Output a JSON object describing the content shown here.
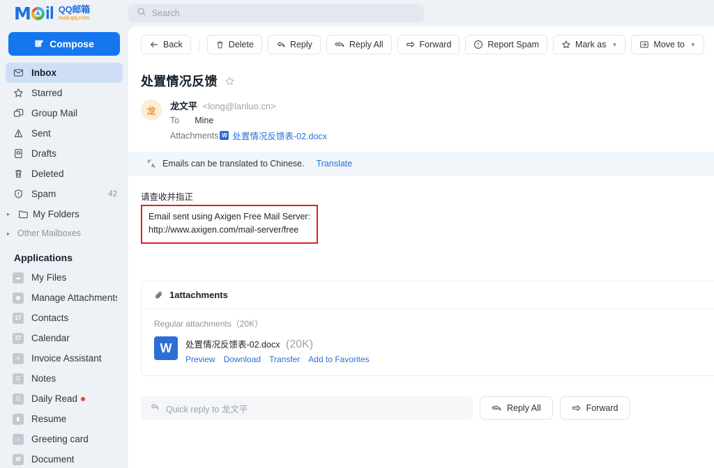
{
  "brand": {
    "word_m": "M",
    "word_il": "il",
    "cn_name": "QQ邮箱",
    "domain": "mail.qq.com"
  },
  "compose": {
    "label": "Compose",
    "icon": "compose-icon"
  },
  "search": {
    "placeholder": "Search",
    "icon": "search-icon"
  },
  "sidebar": {
    "items": [
      {
        "label": "Inbox",
        "icon": "inbox-icon",
        "count": "",
        "active": true
      },
      {
        "label": "Starred",
        "icon": "star-icon",
        "count": "",
        "active": false
      },
      {
        "label": "Group Mail",
        "icon": "group-mail-icon",
        "count": "",
        "active": false
      },
      {
        "label": "Sent",
        "icon": "sent-icon",
        "count": "",
        "active": false
      },
      {
        "label": "Drafts",
        "icon": "drafts-icon",
        "count": "",
        "active": false
      },
      {
        "label": "Deleted",
        "icon": "trash-icon",
        "count": "",
        "active": false
      },
      {
        "label": "Spam",
        "icon": "shield-icon",
        "count": "42",
        "active": false
      }
    ],
    "my_folders": {
      "label": "My Folders",
      "icon": "folder-icon"
    },
    "other_mailboxes": {
      "label": "Other Mailboxes"
    },
    "applications_title": "Applications",
    "applications": [
      {
        "label": "My Files",
        "icon": "cloud-icon",
        "glyph": "☁",
        "dot": false
      },
      {
        "label": "Manage Attachments",
        "icon": "attachment-box-icon",
        "glyph": "▣",
        "dot": false
      },
      {
        "label": "Contacts",
        "icon": "contacts-icon",
        "glyph": "17",
        "dot": false
      },
      {
        "label": "Calendar",
        "icon": "calendar-icon",
        "glyph": "27",
        "dot": false
      },
      {
        "label": "Invoice Assistant",
        "icon": "invoice-icon",
        "glyph": "≡",
        "dot": false
      },
      {
        "label": "Notes",
        "icon": "notes-icon",
        "glyph": "☰",
        "dot": false
      },
      {
        "label": "Daily Read",
        "icon": "daily-read-icon",
        "glyph": "☰",
        "dot": true
      },
      {
        "label": "Resume",
        "icon": "resume-icon",
        "glyph": "▮",
        "dot": false
      },
      {
        "label": "Greeting card",
        "icon": "greeting-card-icon",
        "glyph": "♪",
        "dot": false
      },
      {
        "label": "Document",
        "icon": "document-icon",
        "glyph": "W",
        "dot": false
      }
    ]
  },
  "toolbar": {
    "back": "Back",
    "delete": "Delete",
    "reply": "Reply",
    "reply_all": "Reply All",
    "forward": "Forward",
    "report_spam": "Report Spam",
    "mark_as": "Mark as",
    "move_to": "Move to"
  },
  "email": {
    "subject": "处置情况反馈",
    "avatar_initial": "龙",
    "sender_name": "龙文平",
    "sender_address": "<long@lanluo.cn>",
    "to_label": "To",
    "to_value": "Mine",
    "attachments_label": "Attachments",
    "attachment_chip": "W",
    "attachment_inline_name": "处置情况反馈表-02.docx",
    "body_line_cn": "请查收并指正",
    "annotation_line1": "Email sent using Axigen Free Mail Server:",
    "annotation_line2": "http://www.axigen.com/mail-server/free",
    "annotation_border_color": "#e02020"
  },
  "translate_banner": {
    "text": "Emails can be translated to Chinese.",
    "action": "Translate",
    "icon": "translate-icon"
  },
  "attachments_panel": {
    "header": "1attachments",
    "header_icon": "paperclip-icon",
    "group_label": "Regular attachments（20K）",
    "items": [
      {
        "file_icon": "word-doc-icon",
        "file_glyph": "W",
        "name": "处置情况反馈表-02.docx",
        "size": "(20K)",
        "actions": [
          "Preview",
          "Download",
          "Transfer",
          "Add to Favorites"
        ]
      }
    ]
  },
  "quick_reply": {
    "placeholder": "Quick reply to 龙文平",
    "icon": "reply-icon",
    "reply_all": "Reply All",
    "forward": "Forward"
  },
  "colors": {
    "accent": "#1577ef",
    "link": "#2b6fd6",
    "app_bg": "#eef1f5",
    "active_nav": "#cfe0f6",
    "avatar_bg": "#fbeed6",
    "avatar_fg": "#e8973a",
    "badge_red": "#f04438"
  }
}
